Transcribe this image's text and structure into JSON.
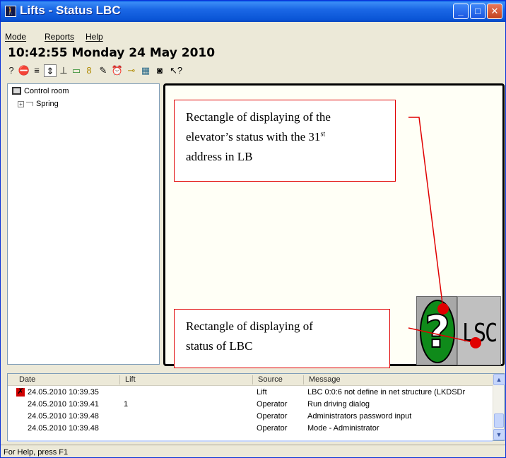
{
  "window": {
    "title": "Lifts - Status LBC",
    "app_icon_glyph": "🚶",
    "buttons": {
      "minimize": "_",
      "maximize": "□",
      "close": "✕"
    }
  },
  "menu": {
    "items": [
      "Mode",
      "Reports",
      "Help"
    ]
  },
  "clock": "10:42:55 Monday 24 May 2010",
  "toolbar": {
    "icons": [
      {
        "name": "help-icon",
        "glyph": "?"
      },
      {
        "name": "stop-icon",
        "glyph": "⛔"
      },
      {
        "name": "levels-icon",
        "glyph": "≡"
      },
      {
        "name": "lift-icon",
        "glyph": "⇕"
      },
      {
        "name": "ground-icon",
        "glyph": "⊥"
      },
      {
        "name": "display-icon",
        "glyph": "▭"
      },
      {
        "name": "person-icon",
        "glyph": "8"
      },
      {
        "name": "edit-icon",
        "glyph": "✎"
      },
      {
        "name": "alarm-clock-icon",
        "glyph": "⏰"
      },
      {
        "name": "key-icon",
        "glyph": "⊸"
      },
      {
        "name": "map-icon",
        "glyph": "▦"
      },
      {
        "name": "camera-icon",
        "glyph": "◙"
      },
      {
        "name": "whats-this-icon",
        "glyph": "↖?"
      }
    ],
    "pressed_index": 3
  },
  "tree": {
    "root": "Control room",
    "child": "Spring",
    "expander": "+"
  },
  "annotations": {
    "top_line1": "Rectangle of displaying of the",
    "top_line2_prefix": "elevator’s status with the 31",
    "top_line2_sup": "st",
    "top_line3": "address in LB",
    "bottom_line1": "Rectangle of displaying of",
    "bottom_line2": "status of LBC"
  },
  "tiles": {
    "lift_status_glyph": "?",
    "lbc_status_text": "LSC"
  },
  "colors": {
    "titlebar": "#0a55d6",
    "annotation": "#e00000",
    "lift_green": "#0f8a1a",
    "display_bg": "#fffff6",
    "window_bg": "#ece9d8"
  },
  "log": {
    "columns": [
      "Date",
      "Lift",
      "Source",
      "Message"
    ],
    "rows": [
      {
        "date": "24.05.2010 10:39.35",
        "lift": "",
        "source": "Lift",
        "message": "LBC 0:0:6 not define in net structure (LKDSDr",
        "error": true
      },
      {
        "date": "24.05.2010 10:39.41",
        "lift": "1",
        "source": "Operator",
        "message": "Run driving dialog",
        "error": false
      },
      {
        "date": "24.05.2010 10:39.48",
        "lift": "",
        "source": "Operator",
        "message": "Administrators password input",
        "error": false
      },
      {
        "date": "24.05.2010 10:39.48",
        "lift": "",
        "source": "Operator",
        "message": "Mode - Administrator",
        "error": false
      }
    ],
    "scroll_up": "▲",
    "scroll_down": "▼",
    "error_glyph": "✗"
  },
  "status_bar": "For Help, press F1"
}
